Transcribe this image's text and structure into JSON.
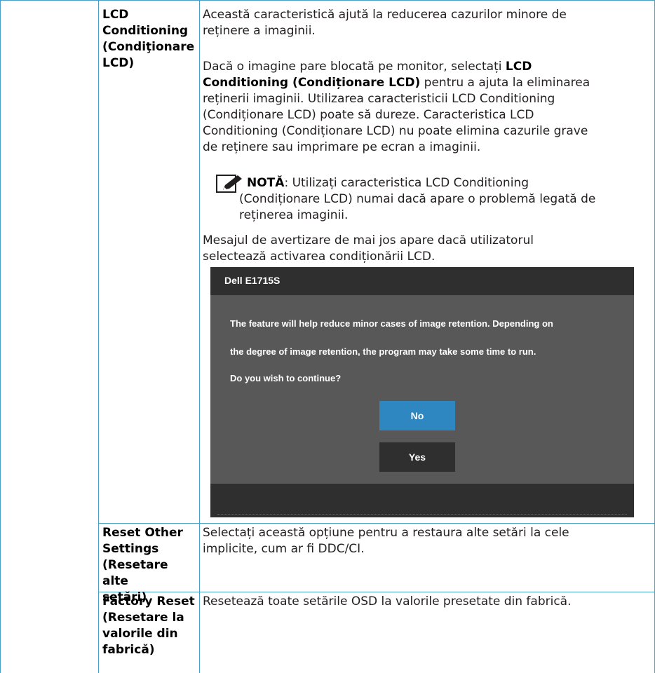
{
  "rows": [
    {
      "label_lines": [
        "LCD",
        "Conditioning",
        "(Condiţionare",
        "LCD)"
      ],
      "intro_lines": [
        "Această caracteristică ajută la reducerea cazurilor minore de",
        "reținere a imaginii."
      ],
      "para2_line1_prefix": "Dacă o imagine pare blocată pe monitor, selectați ",
      "para2_line1_bold": "LCD",
      "para2_line2_bold": "Conditioning (Condiționare LCD)",
      "para2_line2_rest": " pentru a ajuta la eliminarea",
      "para2_rest_lines": [
        "reținerii imaginii. Utilizarea caracteristicii LCD Conditioning",
        "(Condiționare LCD) poate să dureze. Caracteristica LCD",
        "Conditioning (Condiționare LCD) nu poate elimina cazurile grave",
        "de reținere sau imprimare pe ecran a imaginii."
      ],
      "note_label": "NOTĂ",
      "note_line1_rest": ": Utilizați caracteristica LCD Conditioning",
      "note_lines": [
        "(Condiționare LCD) numai dacă apare o problemă legată de",
        "reținerea imaginii."
      ],
      "warn_lines": [
        "Mesajul de avertizare de mai jos apare dacă utilizatorul",
        "selectează activarea condiționării LCD."
      ]
    },
    {
      "label_lines": [
        "Reset Other",
        "Settings",
        "(Resetare alte",
        "setări)"
      ],
      "desc_lines": [
        "Selectați această opțiune pentru a restaura alte setări la cele",
        "implicite, cum ar fi DDC/CI."
      ]
    },
    {
      "label_lines": [
        "Factory Reset",
        "(Resetare la",
        "valorile din",
        "fabrică)"
      ],
      "desc_lines": [
        "Resetează toate setările OSD la valorile presetate din fabrică."
      ]
    }
  ],
  "dialog": {
    "title": "Dell E1715S",
    "messages": [
      "The feature will help reduce minor cases of image retention. Depending on",
      "the degree of image retention, the program may take some time to run.",
      "Do you wish to continue?"
    ],
    "no_label": "No",
    "yes_label": "Yes"
  },
  "colors": {
    "table_border": "#4a9fc6",
    "dialog_bg": "#585858",
    "dialog_bar": "#2f2f2f",
    "button_selected": "#2f87c2"
  },
  "icons": {
    "note": "pencil-note-icon"
  }
}
